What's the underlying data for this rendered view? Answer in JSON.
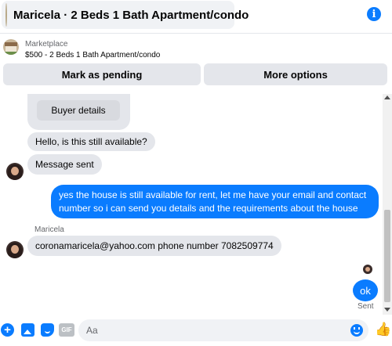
{
  "header": {
    "title": "Maricela · 2 Beds 1 Bath Apartment/condo",
    "info_icon": "info-icon",
    "info_glyph": "i"
  },
  "marketplace": {
    "label": "Marketplace",
    "listing": "$500 - 2 Beds 1 Bath Apartment/condo",
    "mark_pending_label": "Mark as pending",
    "more_options_label": "More options"
  },
  "chat": {
    "buyer_details_label": "Buyer details",
    "messages": [
      {
        "from": "buyer",
        "text": "Hello, is this still available?"
      },
      {
        "from": "buyer",
        "text": "Message sent"
      },
      {
        "from": "seller",
        "text": "yes the house is still available for rent, let me have your email  and contact number so i can send you details and the requirements about the house"
      },
      {
        "from": "buyer",
        "sender_name": "Maricela",
        "text": "coronamaricela@yahoo.com phone number 7082509774"
      },
      {
        "from": "seller",
        "text": "ok"
      }
    ],
    "sent_status": "Sent"
  },
  "composer": {
    "placeholder": "Aa",
    "gif_label": "GIF",
    "plus_glyph": "+",
    "like_glyph": "👍"
  },
  "colors": {
    "accent": "#0a7cff",
    "bubble_incoming": "#e4e6eb",
    "muted_text": "#65676b"
  }
}
